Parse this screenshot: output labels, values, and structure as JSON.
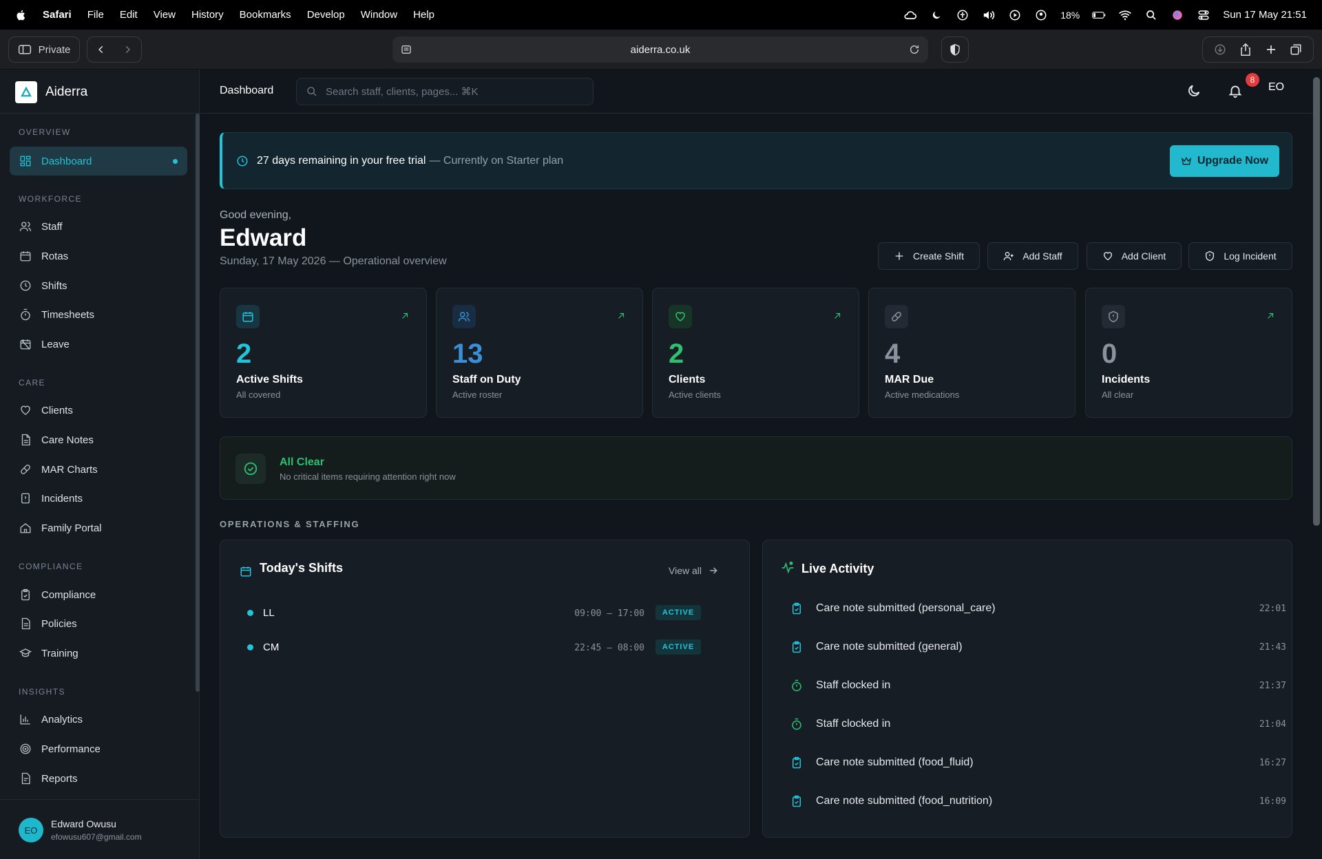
{
  "os_menubar": {
    "app": "Safari",
    "menus": [
      "File",
      "Edit",
      "View",
      "History",
      "Bookmarks",
      "Develop",
      "Window",
      "Help"
    ],
    "battery": "18%",
    "datetime": "Sun 17 May  21:51"
  },
  "browser": {
    "private_label": "Private",
    "url": "aiderra.co.uk"
  },
  "sidebar": {
    "brand": "Aiderra",
    "sections": {
      "overview": "OVERVIEW",
      "workforce": "WORKFORCE",
      "care": "CARE",
      "compliance": "COMPLIANCE",
      "insights": "INSIGHTS"
    },
    "items": {
      "dashboard": "Dashboard",
      "staff": "Staff",
      "rotas": "Rotas",
      "shifts": "Shifts",
      "timesheets": "Timesheets",
      "leave": "Leave",
      "clients": "Clients",
      "care_notes": "Care Notes",
      "mar_charts": "MAR Charts",
      "incidents": "Incidents",
      "family_portal": "Family Portal",
      "compliance": "Compliance",
      "policies": "Policies",
      "training": "Training",
      "analytics": "Analytics",
      "performance": "Performance",
      "reports": "Reports"
    },
    "user": {
      "initials": "EO",
      "name": "Edward Owusu",
      "email": "efowusu607@gmail.com"
    }
  },
  "header": {
    "breadcrumb": "Dashboard",
    "search_placeholder": "Search staff, clients, pages... ⌘K",
    "notification_count": "8",
    "avatar_initials": "EO"
  },
  "trial": {
    "message": "27 days remaining in your free trial",
    "plan": "— Currently on Starter plan",
    "upgrade_label": "Upgrade Now"
  },
  "greeting": {
    "salutation": "Good evening,",
    "name": "Edward",
    "date_line": "Sunday, 17 May 2026 — Operational overview"
  },
  "quick_actions": {
    "create_shift": "Create Shift",
    "add_staff": "Add Staff",
    "add_client": "Add Client",
    "log_incident": "Log Incident"
  },
  "stats": [
    {
      "value": "2",
      "label": "Active Shifts",
      "sub": "All covered",
      "color": "#22c4d9"
    },
    {
      "value": "13",
      "label": "Staff on Duty",
      "sub": "Active roster",
      "color": "#3b8fd6"
    },
    {
      "value": "2",
      "label": "Clients",
      "sub": "Active clients",
      "color": "#2fbf71"
    },
    {
      "value": "4",
      "label": "MAR Due",
      "sub": "Active medications",
      "color": "#8a939d"
    },
    {
      "value": "0",
      "label": "Incidents",
      "sub": "All clear",
      "color": "#8a939d"
    }
  ],
  "all_clear": {
    "title": "All Clear",
    "subtitle": "No critical items requiring attention right now"
  },
  "section_title": "OPERATIONS & STAFFING",
  "shifts_panel": {
    "title": "Today's Shifts",
    "view_all": "View all",
    "rows": [
      {
        "name": "LL",
        "time": "09:00 — 17:00",
        "status": "ACTIVE"
      },
      {
        "name": "CM",
        "time": "22:45 — 08:00",
        "status": "ACTIVE"
      }
    ]
  },
  "activity_panel": {
    "title": "Live Activity",
    "rows": [
      {
        "text": "Care note submitted (personal_care)",
        "time": "22:01",
        "icon": "clipboard-icon"
      },
      {
        "text": "Care note submitted (general)",
        "time": "21:43",
        "icon": "clipboard-icon"
      },
      {
        "text": "Staff clocked in",
        "time": "21:37",
        "icon": "timer-icon"
      },
      {
        "text": "Staff clocked in",
        "time": "21:04",
        "icon": "timer-icon"
      },
      {
        "text": "Care note submitted (food_fluid)",
        "time": "16:27",
        "icon": "clipboard-icon"
      },
      {
        "text": "Care note submitted (food_nutrition)",
        "time": "16:09",
        "icon": "clipboard-icon"
      }
    ]
  }
}
